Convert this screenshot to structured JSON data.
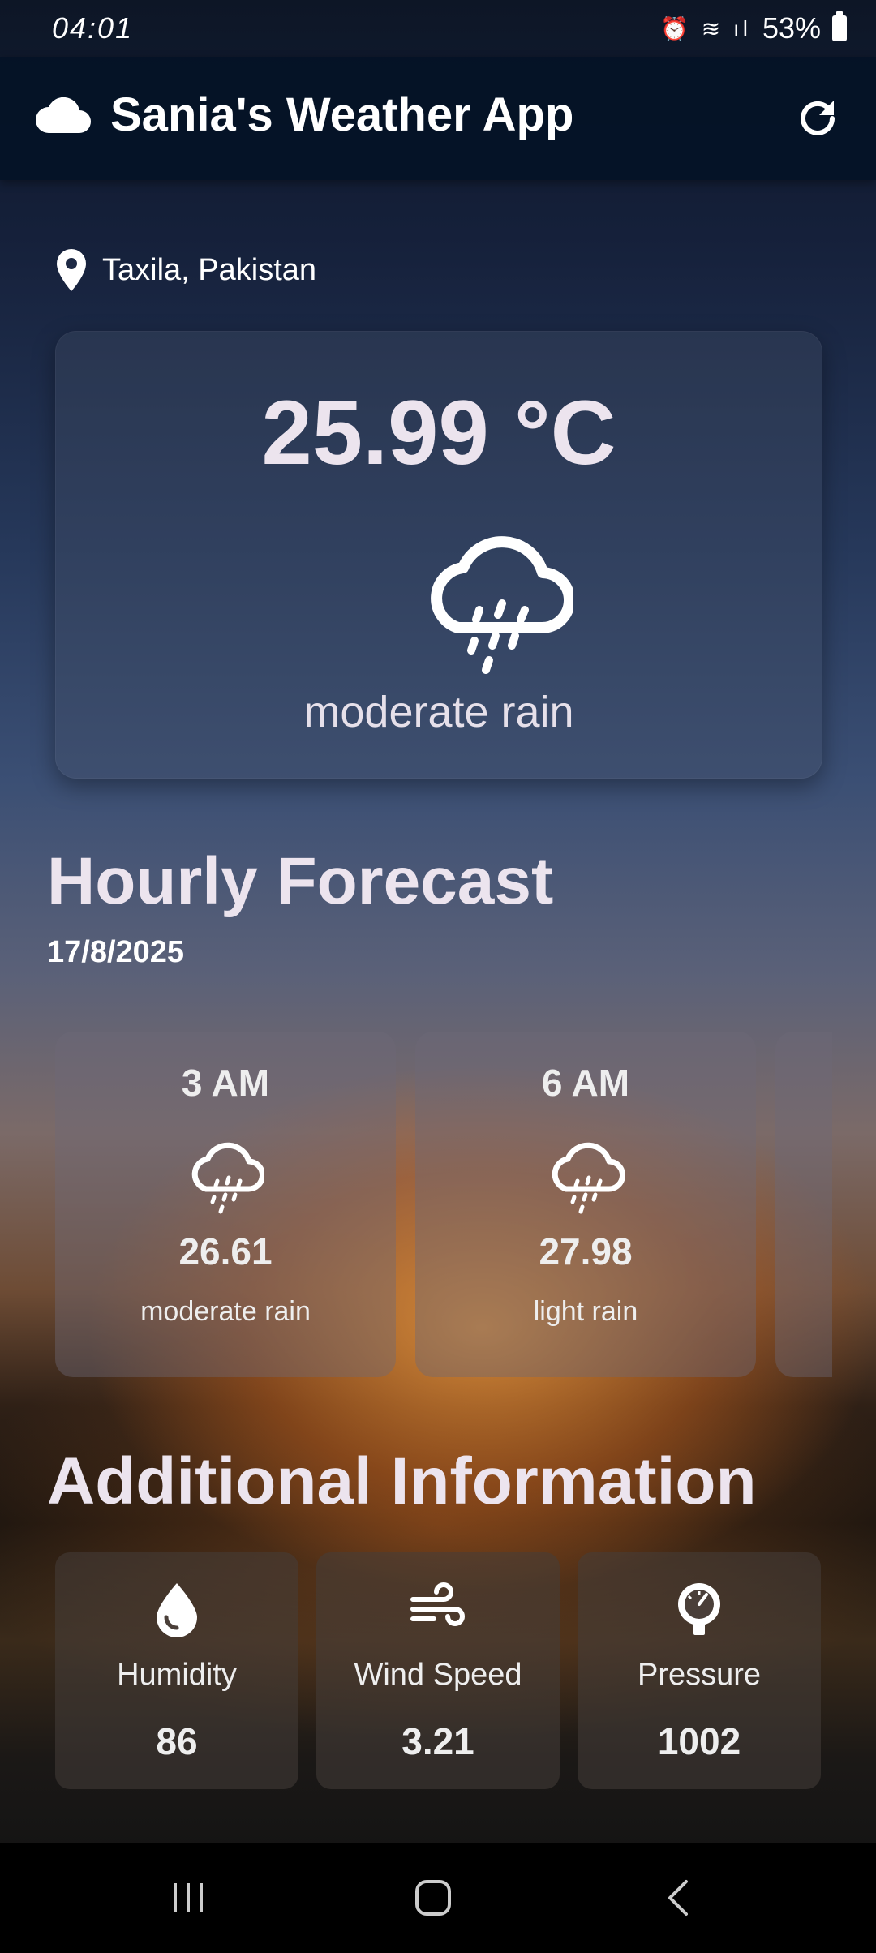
{
  "status": {
    "time": "04:01",
    "battery": "53%"
  },
  "app_bar": {
    "title": "Sania's Weather App",
    "icons": [
      "cloud-icon",
      "refresh-icon"
    ]
  },
  "location": "Taxila, Pakistan",
  "current": {
    "temperature": "25.99 °C",
    "condition": "moderate rain",
    "icon": "rain-cloud-icon"
  },
  "hourly": {
    "title": "Hourly Forecast",
    "date": "17/8/2025",
    "items": [
      {
        "time": "3 AM",
        "temp": "26.61",
        "condition": "moderate rain",
        "icon": "rain-cloud-icon"
      },
      {
        "time": "6 AM",
        "temp": "27.98",
        "condition": "light rain",
        "icon": "rain-cloud-icon"
      }
    ]
  },
  "additional": {
    "title": "Additional Information",
    "items": [
      {
        "label": "Humidity",
        "value": "86",
        "icon": "water-drop-icon"
      },
      {
        "label": "Wind Speed",
        "value": "3.21",
        "icon": "wind-icon"
      },
      {
        "label": "Pressure",
        "value": "1002",
        "icon": "gauge-icon"
      }
    ]
  },
  "colors": {
    "app_bar": "#04122a",
    "text": "#ece4ee"
  }
}
